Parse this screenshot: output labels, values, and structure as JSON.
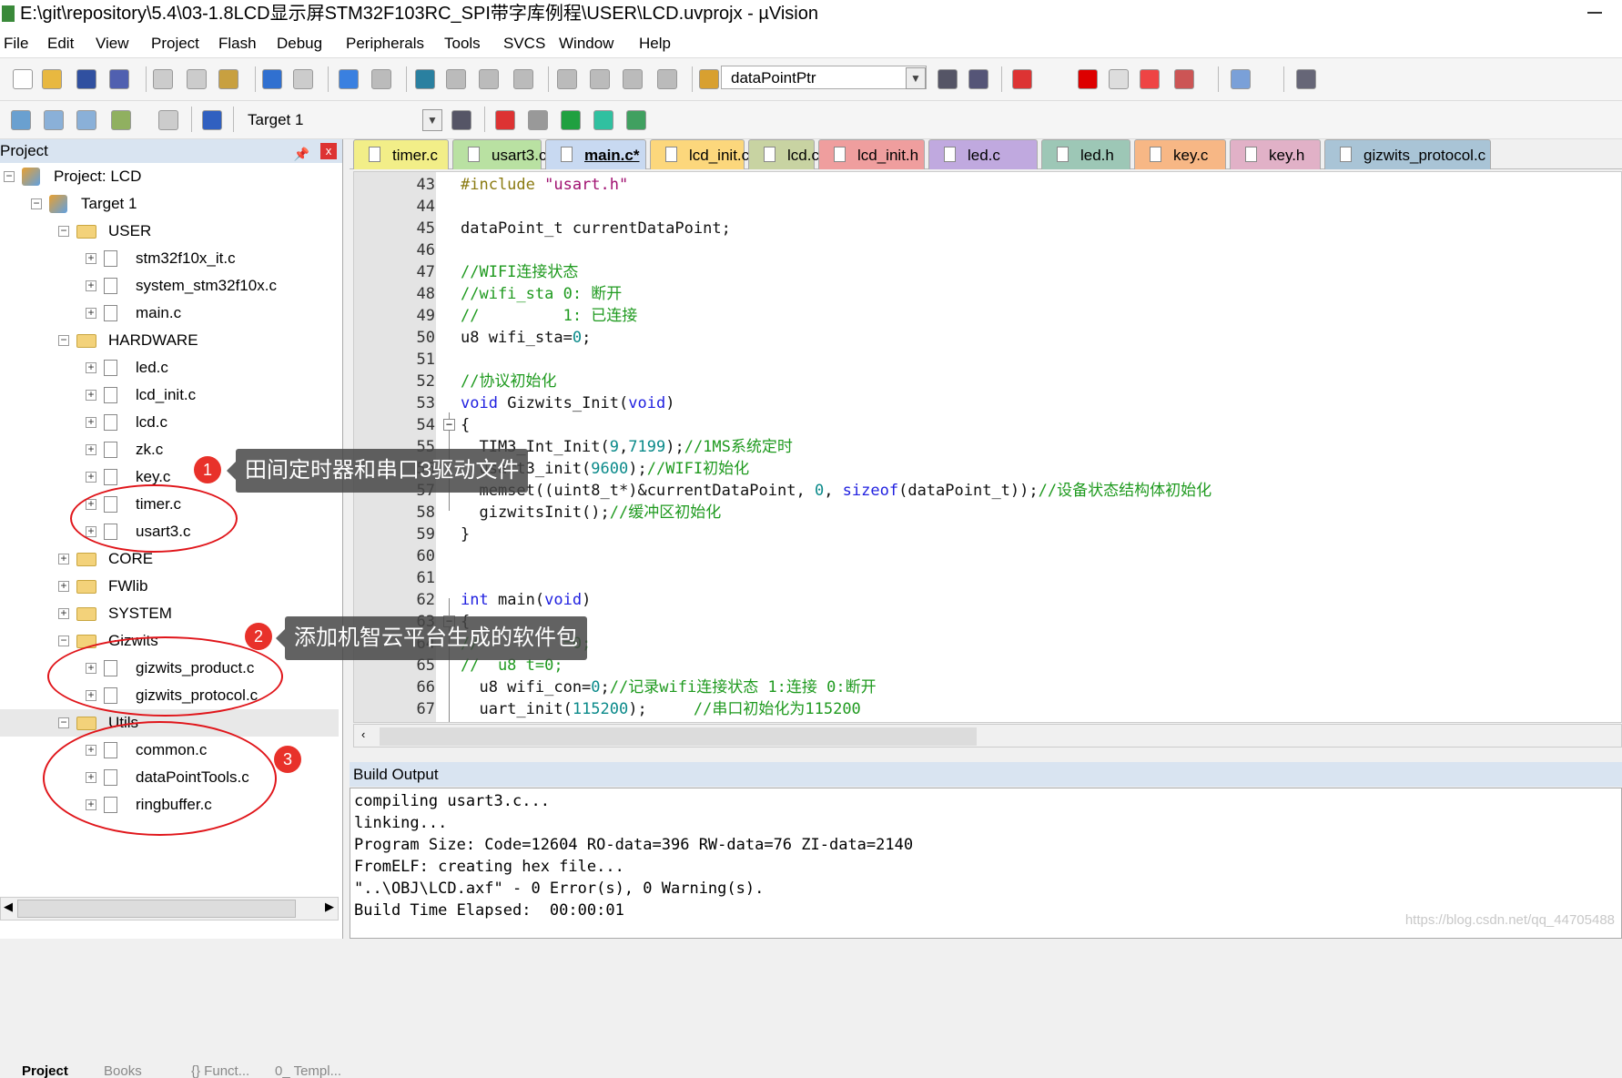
{
  "window": {
    "title": "E:\\git\\repository\\5.4\\03-1.8LCD显示屏STM32F103RC_SPI带字库例程\\USER\\LCD.uvprojx - µVision"
  },
  "menu": [
    "File",
    "Edit",
    "View",
    "Project",
    "Flash",
    "Debug",
    "Peripherals",
    "Tools",
    "SVCS",
    "Window",
    "Help"
  ],
  "toolbar": {
    "symbol_combo": "dataPointPtr",
    "target_combo": "Target 1"
  },
  "project_panel": {
    "title": "Project",
    "tree": [
      {
        "label": "Project: LCD",
        "level": 0,
        "kind": "project",
        "exp": "-"
      },
      {
        "label": "Target 1",
        "level": 1,
        "kind": "target",
        "exp": "-"
      },
      {
        "label": "USER",
        "level": 2,
        "kind": "folder",
        "exp": "-"
      },
      {
        "label": "stm32f10x_it.c",
        "level": 3,
        "kind": "file",
        "exp": "+"
      },
      {
        "label": "system_stm32f10x.c",
        "level": 3,
        "kind": "file",
        "exp": "+"
      },
      {
        "label": "main.c",
        "level": 3,
        "kind": "file",
        "exp": "+"
      },
      {
        "label": "HARDWARE",
        "level": 2,
        "kind": "folder",
        "exp": "-"
      },
      {
        "label": "led.c",
        "level": 3,
        "kind": "file",
        "exp": "+"
      },
      {
        "label": "lcd_init.c",
        "level": 3,
        "kind": "file",
        "exp": "+"
      },
      {
        "label": "lcd.c",
        "level": 3,
        "kind": "file",
        "exp": "+"
      },
      {
        "label": "zk.c",
        "level": 3,
        "kind": "file",
        "exp": "+"
      },
      {
        "label": "key.c",
        "level": 3,
        "kind": "file",
        "exp": "+"
      },
      {
        "label": "timer.c",
        "level": 3,
        "kind": "file",
        "exp": "+"
      },
      {
        "label": "usart3.c",
        "level": 3,
        "kind": "file",
        "exp": "+"
      },
      {
        "label": "CORE",
        "level": 2,
        "kind": "folder",
        "exp": "+"
      },
      {
        "label": "FWlib",
        "level": 2,
        "kind": "folder",
        "exp": "+"
      },
      {
        "label": "SYSTEM",
        "level": 2,
        "kind": "folder",
        "exp": "+"
      },
      {
        "label": "Gizwits",
        "level": 2,
        "kind": "folder",
        "exp": "-"
      },
      {
        "label": "gizwits_product.c",
        "level": 3,
        "kind": "file",
        "exp": "+"
      },
      {
        "label": "gizwits_protocol.c",
        "level": 3,
        "kind": "file",
        "exp": "+"
      },
      {
        "label": "Utils",
        "level": 2,
        "kind": "folder",
        "exp": "-",
        "selected": true
      },
      {
        "label": "common.c",
        "level": 3,
        "kind": "file",
        "exp": "+"
      },
      {
        "label": "dataPointTools.c",
        "level": 3,
        "kind": "file",
        "exp": "+"
      },
      {
        "label": "ringbuffer.c",
        "level": 3,
        "kind": "file",
        "exp": "+"
      }
    ],
    "bottom_tabs": [
      "Project",
      "Books",
      "{} Funct...",
      "0_ Templ..."
    ]
  },
  "editor": {
    "tabs": [
      {
        "label": "timer.c",
        "color": "#f2ee88"
      },
      {
        "label": "usart3.c",
        "color": "#b9e1a2"
      },
      {
        "label": "main.c*",
        "color": "#c8d9f1",
        "active": true
      },
      {
        "label": "lcd_init.c",
        "color": "#fcd77c"
      },
      {
        "label": "lcd.c",
        "color": "#c8d3a2"
      },
      {
        "label": "lcd_init.h",
        "color": "#ef9e9e"
      },
      {
        "label": "led.c",
        "color": "#c0a9df"
      },
      {
        "label": "led.h",
        "color": "#9dc7b6"
      },
      {
        "label": "key.c",
        "color": "#f7b785"
      },
      {
        "label": "key.h",
        "color": "#e1b1c7"
      },
      {
        "label": "gizwits_protocol.c",
        "color": "#a9c4d6"
      }
    ],
    "lines": [
      {
        "n": "43",
        "seg": [
          [
            "#include ",
            "pp"
          ],
          [
            "\"usart.h\"",
            "str"
          ]
        ]
      },
      {
        "n": "44",
        "seg": []
      },
      {
        "n": "45",
        "seg": [
          [
            "dataPoint_t currentDataPoint;",
            "pl"
          ]
        ]
      },
      {
        "n": "46",
        "seg": []
      },
      {
        "n": "47",
        "seg": [
          [
            "//WIFI连接状态",
            "com"
          ]
        ]
      },
      {
        "n": "48",
        "seg": [
          [
            "//wifi_sta 0: 断开",
            "com"
          ]
        ]
      },
      {
        "n": "49",
        "seg": [
          [
            "//         1: 已连接",
            "com"
          ]
        ]
      },
      {
        "n": "50",
        "seg": [
          [
            "u8 wifi_sta=",
            "pl"
          ],
          [
            "0",
            "num"
          ],
          [
            ";",
            "pl"
          ]
        ]
      },
      {
        "n": "51",
        "seg": []
      },
      {
        "n": "52",
        "seg": [
          [
            "//协议初始化",
            "com"
          ]
        ]
      },
      {
        "n": "53",
        "seg": [
          [
            "void ",
            "kw"
          ],
          [
            "Gizwits_Init(",
            "pl"
          ],
          [
            "void",
            "kw"
          ],
          [
            ")",
            "pl"
          ]
        ]
      },
      {
        "n": "54",
        "seg": [
          [
            "{",
            "pl"
          ]
        ],
        "fold": true
      },
      {
        "n": "55",
        "seg": [
          [
            "  TIM3_Int_Init(",
            "pl"
          ],
          [
            "9",
            "num"
          ],
          [
            ",",
            "pl"
          ],
          [
            "7199",
            "num"
          ],
          [
            ");",
            "pl"
          ],
          [
            "//1MS系统定时",
            "com"
          ]
        ]
      },
      {
        "n": "56",
        "seg": [
          [
            "  usart3_init(",
            "pl"
          ],
          [
            "9600",
            "num"
          ],
          [
            ");",
            "pl"
          ],
          [
            "//WIFI初始化",
            "com"
          ]
        ]
      },
      {
        "n": "57",
        "seg": [
          [
            "  memset((uint8_t*)&currentDataPoint, ",
            "pl"
          ],
          [
            "0",
            "num"
          ],
          [
            ", ",
            "pl"
          ],
          [
            "sizeof",
            "kw"
          ],
          [
            "(dataPoint_t));",
            "pl"
          ],
          [
            "//设备状态结构体初始化",
            "com"
          ]
        ]
      },
      {
        "n": "58",
        "seg": [
          [
            "  gizwitsInit();",
            "pl"
          ],
          [
            "//缓冲区初始化",
            "com"
          ]
        ]
      },
      {
        "n": "59",
        "seg": [
          [
            "}",
            "pl"
          ]
        ]
      },
      {
        "n": "60",
        "seg": []
      },
      {
        "n": "61",
        "seg": []
      },
      {
        "n": "62",
        "seg": [
          [
            "int ",
            "kw"
          ],
          [
            "main(",
            "pl"
          ],
          [
            "void",
            "kw"
          ],
          [
            ")",
            "pl"
          ]
        ]
      },
      {
        "n": "63",
        "seg": [
          [
            "{",
            "pl"
          ]
        ],
        "fold": true
      },
      {
        "n": "64",
        "seg": [
          [
            "//         =0;",
            "com"
          ]
        ]
      },
      {
        "n": "65",
        "seg": [
          [
            "//  u8 t=0;",
            "com"
          ]
        ]
      },
      {
        "n": "66",
        "seg": [
          [
            "  u8 wifi_con=",
            "pl"
          ],
          [
            "0",
            "num"
          ],
          [
            ";",
            "pl"
          ],
          [
            "//记录wifi连接状态 1:连接 0:断开",
            "com"
          ]
        ]
      },
      {
        "n": "67",
        "seg": [
          [
            "  uart_init(",
            "pl"
          ],
          [
            "115200",
            "num"
          ],
          [
            ");     ",
            "pl"
          ],
          [
            "//串口初始化为115200",
            "com"
          ]
        ]
      }
    ]
  },
  "build": {
    "title": "Build Output",
    "lines": [
      "compiling usart3.c...",
      "linking...",
      "Program Size: Code=12604 RO-data=396 RW-data=76 ZI-data=2140",
      "FromELF: creating hex file...",
      "\"..\\OBJ\\LCD.axf\" - 0 Error(s), 0 Warning(s).",
      "Build Time Elapsed:  00:00:01"
    ]
  },
  "annotations": [
    {
      "num": "1",
      "text": "田间定时器和串口3驱动文件"
    },
    {
      "num": "2",
      "text": "添加机智云平台生成的软件包"
    },
    {
      "num": "3",
      "text": ""
    }
  ],
  "watermark": "https://blog.csdn.net/qq_44705488"
}
